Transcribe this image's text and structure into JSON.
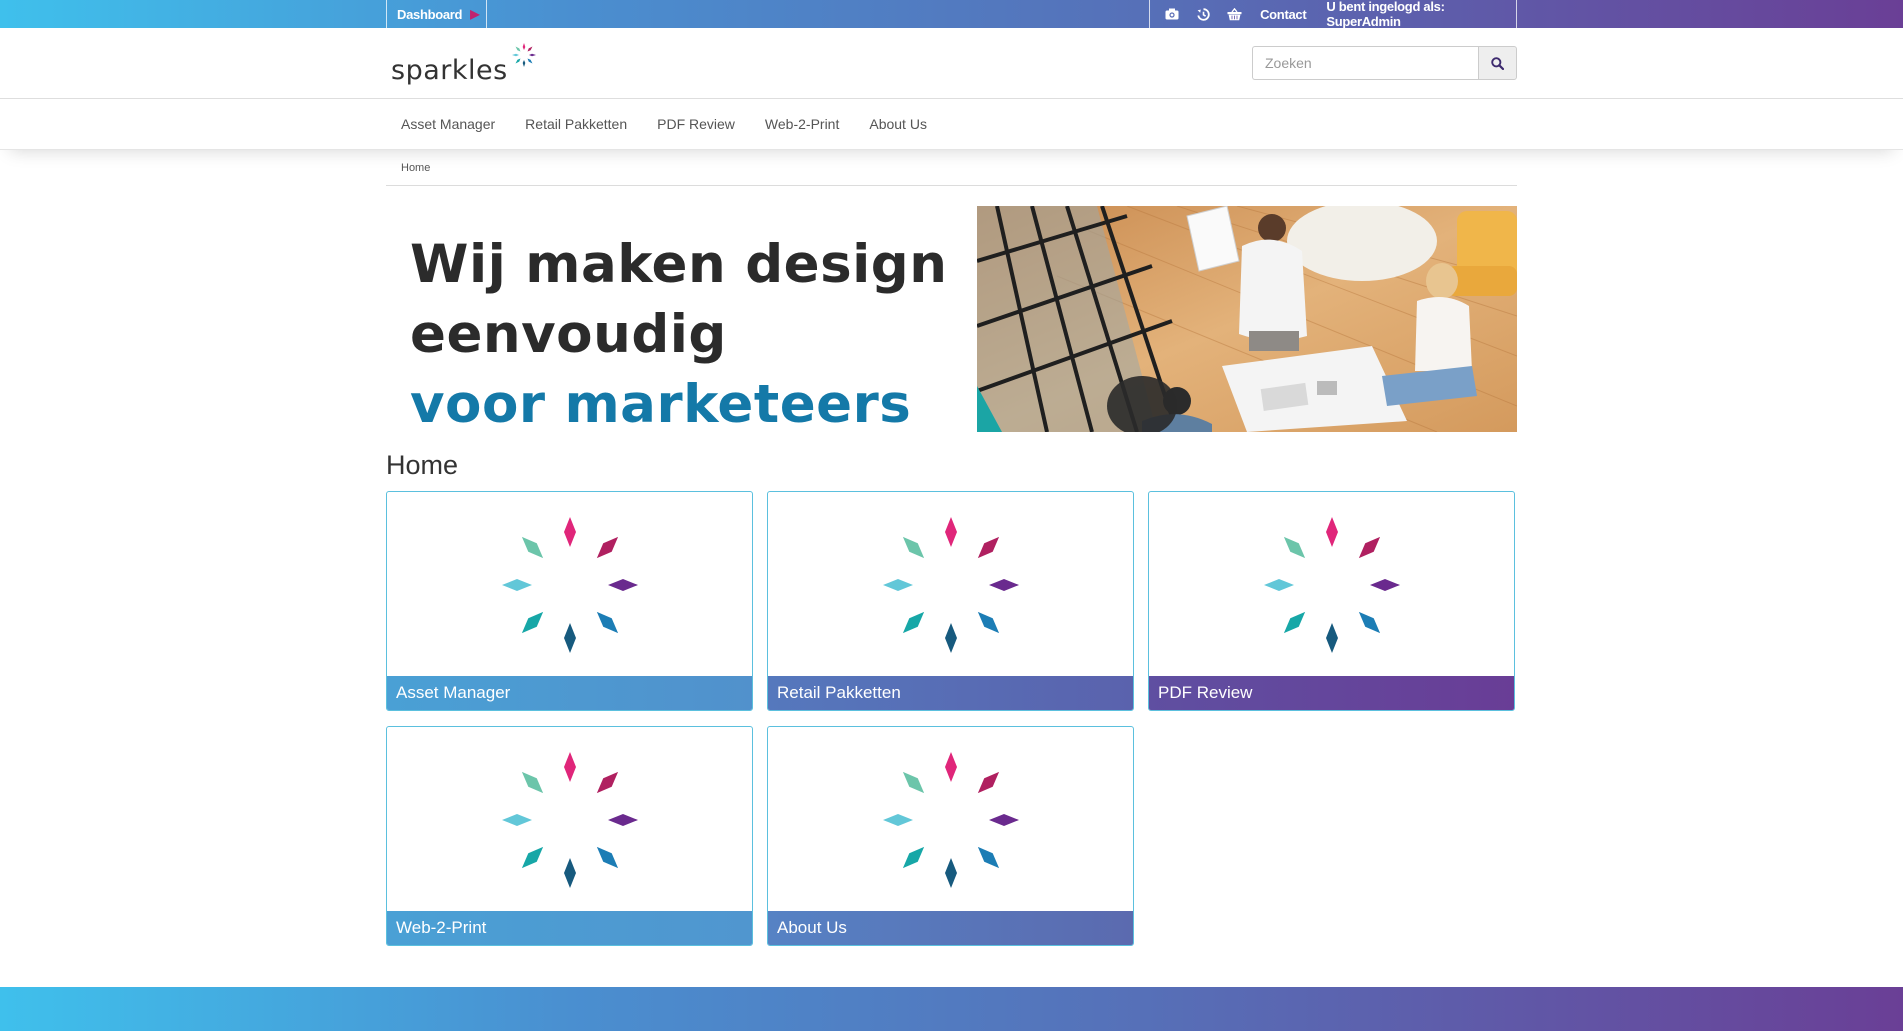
{
  "topbar": {
    "dashboard_label": "Dashboard",
    "contact_label": "Contact",
    "user_label": "U bent ingelogd als: SuperAdmin",
    "icons": [
      "camera-icon",
      "history-icon",
      "basket-icon"
    ]
  },
  "header": {
    "logo_text": "sparkles",
    "search_placeholder": "Zoeken"
  },
  "nav": {
    "items": [
      {
        "label": "Asset Manager"
      },
      {
        "label": "Retail Pakketten"
      },
      {
        "label": "PDF Review"
      },
      {
        "label": "Web-2-Print"
      },
      {
        "label": "About Us"
      }
    ]
  },
  "breadcrumb": {
    "home": "Home"
  },
  "banner": {
    "line1": "Wij maken design",
    "line2": "eenvoudig",
    "line3": "voor marketeers"
  },
  "main": {
    "title": "Home",
    "tiles": [
      {
        "label": "Asset Manager"
      },
      {
        "label": "Retail Pakketten"
      },
      {
        "label": "PDF Review"
      },
      {
        "label": "Web-2-Print"
      },
      {
        "label": "About Us"
      }
    ]
  },
  "colors": {
    "gradient_start": "#3fc0ec",
    "gradient_end": "#6a3f96",
    "accent_blue": "#1479a8",
    "tile_border": "#5bc0de"
  }
}
